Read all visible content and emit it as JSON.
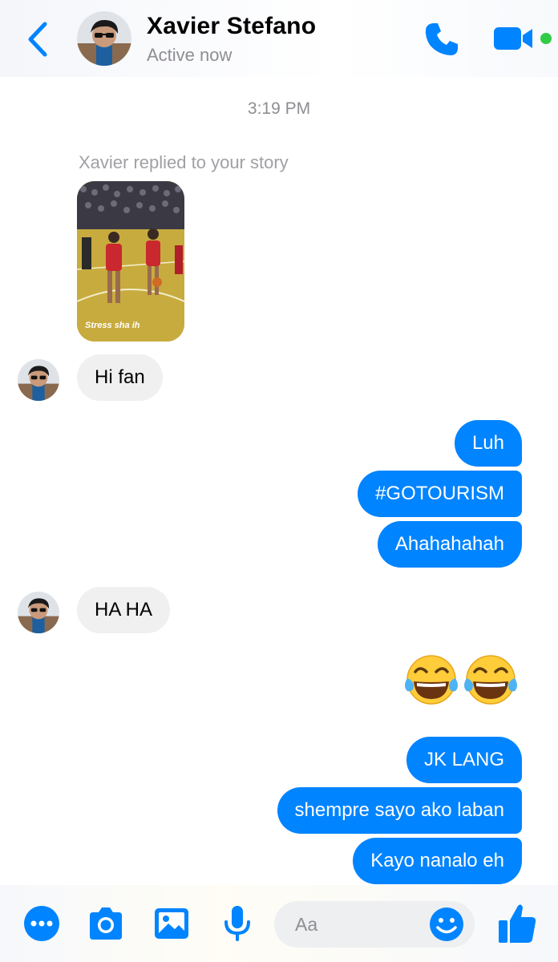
{
  "header": {
    "name": "Xavier Stefano",
    "status": "Active now"
  },
  "thread": {
    "timestamp": "3:19 PM",
    "story_note": "Xavier replied to your story",
    "story_caption": "Stress sha ih"
  },
  "messages": [
    {
      "from": "them",
      "text": "Hi fan"
    },
    {
      "from": "me",
      "text": "Luh"
    },
    {
      "from": "me",
      "text": "#GOTOURISM"
    },
    {
      "from": "me",
      "text": "Ahahahahah"
    },
    {
      "from": "them",
      "text": "HA HA"
    },
    {
      "from": "me",
      "emoji": "face-with-tears-of-joy x2"
    },
    {
      "from": "me",
      "text": "JK LANG"
    },
    {
      "from": "me",
      "text": "shempre sayo ako laban"
    },
    {
      "from": "me",
      "text": "Kayo nanalo eh"
    }
  ],
  "composer": {
    "placeholder": "Aa"
  },
  "colors": {
    "accent": "#0084ff",
    "incoming_bubble": "#f0f0f0",
    "online": "#31cc46",
    "muted_text": "#8e8e93"
  }
}
